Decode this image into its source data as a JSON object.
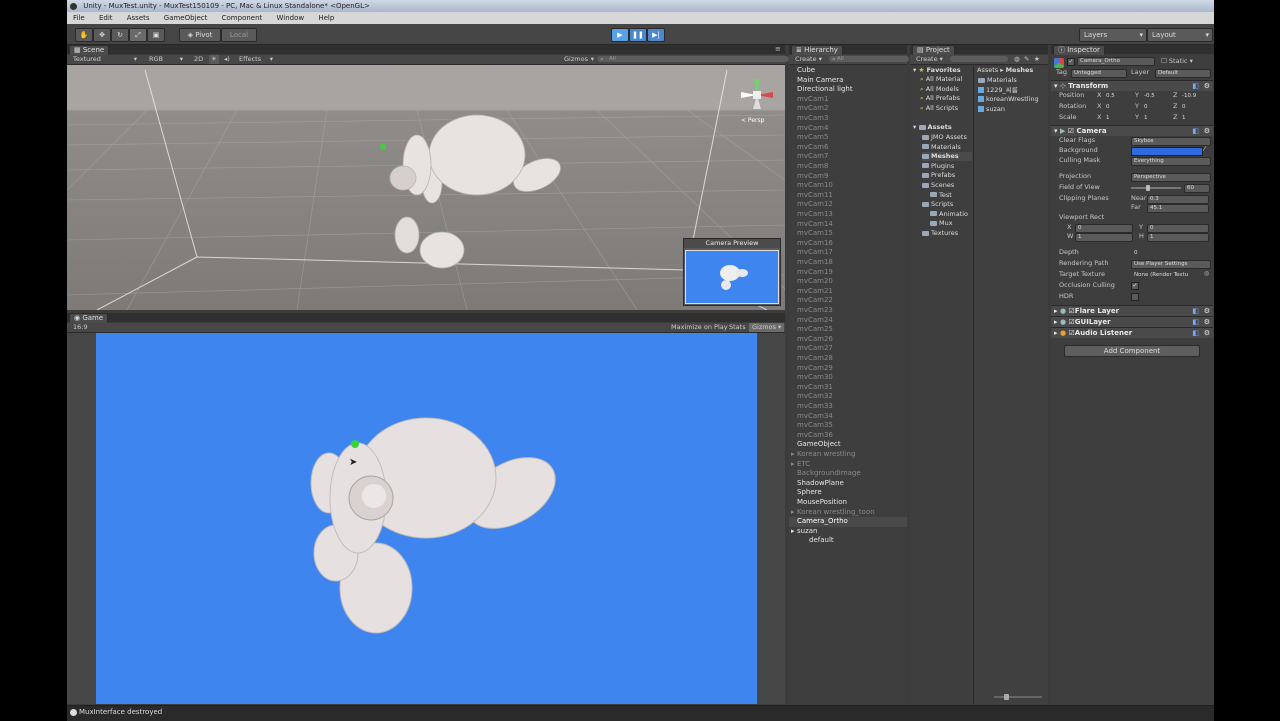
{
  "window": {
    "title": "Unity - MuxTest.unity - MuxTest150109 - PC, Mac & Linux Standalone* <OpenGL>"
  },
  "menu": [
    "File",
    "Edit",
    "Assets",
    "GameObject",
    "Component",
    "Window",
    "Help"
  ],
  "toolbar": {
    "pivot_label": "Pivot",
    "local_label": "Local",
    "layers_label": "Layers",
    "layout_label": "Layout"
  },
  "scene": {
    "tab": "Scene",
    "shading": "Textured",
    "rgb": "RGB",
    "mode_2d": "2D",
    "effects": "Effects",
    "gizmos": "Gizmos",
    "search_placeholder": "All",
    "persp_label": "< Persp",
    "camera_preview_title": "Camera Preview"
  },
  "game": {
    "tab": "Game",
    "aspect": "16:9",
    "maximize_on_play": "Maximize on Play",
    "stats": "Stats",
    "gizmos": "Gizmos"
  },
  "hierarchy": {
    "tab": "Hierarchy",
    "create": "Create",
    "search_placeholder": "All",
    "items": [
      {
        "label": "Cube",
        "style": "bright",
        "indent": 0,
        "arrow": false
      },
      {
        "label": "Main Camera",
        "style": "bright",
        "indent": 0,
        "arrow": false
      },
      {
        "label": "Directional light",
        "style": "bright",
        "indent": 0,
        "arrow": false
      },
      {
        "label": "mvCam1",
        "style": "dim",
        "indent": 0,
        "arrow": false
      },
      {
        "label": "mvCam2",
        "style": "dim",
        "indent": 0,
        "arrow": false
      },
      {
        "label": "mvCam3",
        "style": "dim",
        "indent": 0,
        "arrow": false
      },
      {
        "label": "mvCam4",
        "style": "dim",
        "indent": 0,
        "arrow": false
      },
      {
        "label": "mvCam5",
        "style": "dim",
        "indent": 0,
        "arrow": false
      },
      {
        "label": "mvCam6",
        "style": "dim",
        "indent": 0,
        "arrow": false
      },
      {
        "label": "mvCam7",
        "style": "dim",
        "indent": 0,
        "arrow": false
      },
      {
        "label": "mvCam8",
        "style": "dim",
        "indent": 0,
        "arrow": false
      },
      {
        "label": "mvCam9",
        "style": "dim",
        "indent": 0,
        "arrow": false
      },
      {
        "label": "mvCam10",
        "style": "dim",
        "indent": 0,
        "arrow": false
      },
      {
        "label": "mvCam11",
        "style": "dim",
        "indent": 0,
        "arrow": false
      },
      {
        "label": "mvCam12",
        "style": "dim",
        "indent": 0,
        "arrow": false
      },
      {
        "label": "mvCam13",
        "style": "dim",
        "indent": 0,
        "arrow": false
      },
      {
        "label": "mvCam14",
        "style": "dim",
        "indent": 0,
        "arrow": false
      },
      {
        "label": "mvCam15",
        "style": "dim",
        "indent": 0,
        "arrow": false
      },
      {
        "label": "mvCam16",
        "style": "dim",
        "indent": 0,
        "arrow": false
      },
      {
        "label": "mvCam17",
        "style": "dim",
        "indent": 0,
        "arrow": false
      },
      {
        "label": "mvCam18",
        "style": "dim",
        "indent": 0,
        "arrow": false
      },
      {
        "label": "mvCam19",
        "style": "dim",
        "indent": 0,
        "arrow": false
      },
      {
        "label": "mvCam20",
        "style": "dim",
        "indent": 0,
        "arrow": false
      },
      {
        "label": "mvCam21",
        "style": "dim",
        "indent": 0,
        "arrow": false
      },
      {
        "label": "mvCam22",
        "style": "dim",
        "indent": 0,
        "arrow": false
      },
      {
        "label": "mvCam23",
        "style": "dim",
        "indent": 0,
        "arrow": false
      },
      {
        "label": "mvCam24",
        "style": "dim",
        "indent": 0,
        "arrow": false
      },
      {
        "label": "mvCam25",
        "style": "dim",
        "indent": 0,
        "arrow": false
      },
      {
        "label": "mvCam26",
        "style": "dim",
        "indent": 0,
        "arrow": false
      },
      {
        "label": "mvCam27",
        "style": "dim",
        "indent": 0,
        "arrow": false
      },
      {
        "label": "mvCam28",
        "style": "dim",
        "indent": 0,
        "arrow": false
      },
      {
        "label": "mvCam29",
        "style": "dim",
        "indent": 0,
        "arrow": false
      },
      {
        "label": "mvCam30",
        "style": "dim",
        "indent": 0,
        "arrow": false
      },
      {
        "label": "mvCam31",
        "style": "dim",
        "indent": 0,
        "arrow": false
      },
      {
        "label": "mvCam32",
        "style": "dim",
        "indent": 0,
        "arrow": false
      },
      {
        "label": "mvCam33",
        "style": "dim",
        "indent": 0,
        "arrow": false
      },
      {
        "label": "mvCam34",
        "style": "dim",
        "indent": 0,
        "arrow": false
      },
      {
        "label": "mvCam35",
        "style": "dim",
        "indent": 0,
        "arrow": false
      },
      {
        "label": "mvCam36",
        "style": "dim",
        "indent": 0,
        "arrow": false
      },
      {
        "label": "GameObject",
        "style": "bright",
        "indent": 0,
        "arrow": false
      },
      {
        "label": "Korean wrestling",
        "style": "dim",
        "indent": 0,
        "arrow": true
      },
      {
        "label": "ETC",
        "style": "dim",
        "indent": 0,
        "arrow": true
      },
      {
        "label": "BackgroundImage",
        "style": "dim",
        "indent": 0,
        "arrow": false
      },
      {
        "label": "ShadowPlane",
        "style": "bright",
        "indent": 0,
        "arrow": false
      },
      {
        "label": "Sphere",
        "style": "bright",
        "indent": 0,
        "arrow": false
      },
      {
        "label": "MousePosition",
        "style": "bright",
        "indent": 0,
        "arrow": false
      },
      {
        "label": "Korean wrestling_toon",
        "style": "dim",
        "indent": 0,
        "arrow": true
      },
      {
        "label": "Camera_Ortho",
        "style": "selected",
        "indent": 0,
        "arrow": false
      },
      {
        "label": "suzan",
        "style": "bright",
        "indent": 0,
        "arrow": true
      },
      {
        "label": "default",
        "style": "bright",
        "indent": 1,
        "arrow": false
      }
    ]
  },
  "project": {
    "tab": "Project",
    "create": "Create",
    "favorites_header": "Favorites",
    "favorites": [
      "All Material",
      "All Models",
      "All Prefabs",
      "All Scripts"
    ],
    "assets_header": "Assets",
    "tree": [
      {
        "label": "JMO Assets",
        "level": 1,
        "selected": false
      },
      {
        "label": "Materials",
        "level": 1,
        "selected": false
      },
      {
        "label": "Meshes",
        "level": 1,
        "selected": true
      },
      {
        "label": "Plugins",
        "level": 1,
        "selected": false
      },
      {
        "label": "Prefabs",
        "level": 1,
        "selected": false
      },
      {
        "label": "Scenes",
        "level": 1,
        "selected": false
      },
      {
        "label": "Test",
        "level": 2,
        "selected": false
      },
      {
        "label": "Scripts",
        "level": 1,
        "selected": false
      },
      {
        "label": "Animatio",
        "level": 2,
        "selected": false
      },
      {
        "label": "Mux",
        "level": 2,
        "selected": false
      },
      {
        "label": "Textures",
        "level": 1,
        "selected": false
      }
    ],
    "breadcrumb_root": "Assets",
    "breadcrumb_current": "Meshes",
    "breadcrumb_sep": "▸",
    "files": [
      "Materials",
      "1229_씨름",
      "koreanWrestling",
      "suzan"
    ]
  },
  "inspector": {
    "tab": "Inspector",
    "object_name": "Camera_Ortho",
    "static_label": "Static",
    "tag_label": "Tag",
    "tag_value": "Untagged",
    "layer_label": "Layer",
    "layer_value": "Default",
    "transform": {
      "title": "Transform",
      "rows": [
        {
          "label": "Position",
          "x": "0.5",
          "y": "-0.5",
          "z": "-10.9"
        },
        {
          "label": "Rotation",
          "x": "0",
          "y": "0",
          "z": "0"
        },
        {
          "label": "Scale",
          "x": "1",
          "y": "1",
          "z": "1"
        }
      ]
    },
    "camera": {
      "title": "Camera",
      "clear_flags_label": "Clear Flags",
      "clear_flags_value": "Skybox",
      "background_label": "Background",
      "background_color": "#2f6bdc",
      "culling_mask_label": "Culling Mask",
      "culling_mask_value": "Everything",
      "projection_label": "Projection",
      "projection_value": "Perspective",
      "fov_label": "Field of View",
      "fov_value": "60",
      "fov_fraction": 0.33,
      "clipping_label": "Clipping Planes",
      "near_label": "Near",
      "near_value": "0.3",
      "far_label": "Far",
      "far_value": "45.1",
      "viewport_label": "Viewport Rect",
      "vp_x_label": "X",
      "vp_x": "0",
      "vp_y_label": "Y",
      "vp_y": "0",
      "vp_w_label": "W",
      "vp_w": "1",
      "vp_h_label": "H",
      "vp_h": "1",
      "depth_label": "Depth",
      "depth_value": "0",
      "rendering_path_label": "Rendering Path",
      "rendering_path_value": "Use Player Settings",
      "target_texture_label": "Target Texture",
      "target_texture_value": "None (Render Textu",
      "occlusion_label": "Occlusion Culling",
      "occlusion_checked": true,
      "hdr_label": "HDR",
      "hdr_checked": false
    },
    "components": [
      "Flare Layer",
      "GUILayer",
      "Audio Listener"
    ],
    "add_component": "Add Component"
  },
  "status": {
    "message": "MuxInterface destroyed"
  },
  "colors": {
    "game_bg": "#3f85f0",
    "selection": "#4a4a4a",
    "play_active": "#5aa0e6"
  }
}
